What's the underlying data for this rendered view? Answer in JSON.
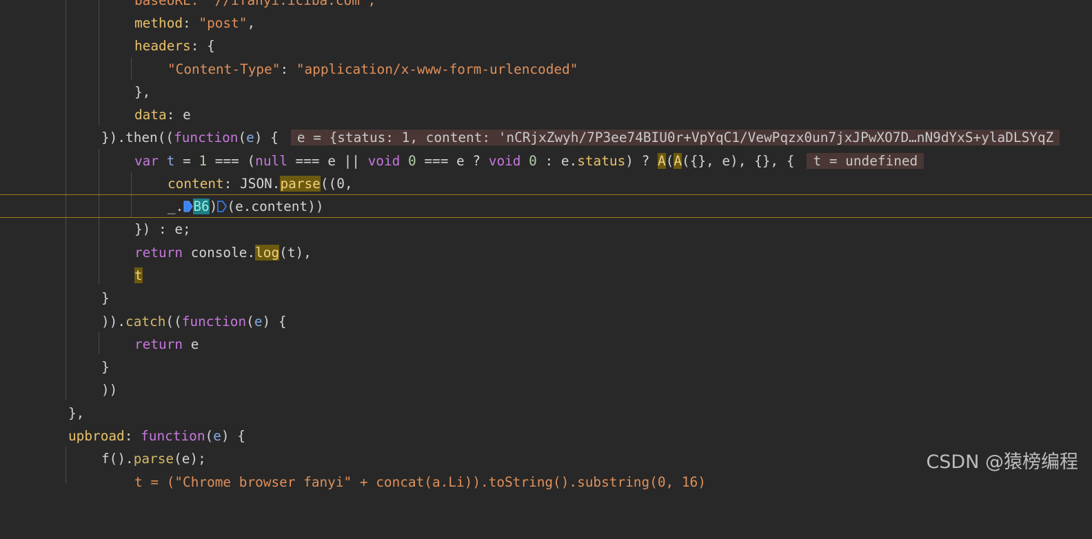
{
  "code_lines": {
    "l0": "baseURL: \"//ifanyi.iciba.com\",",
    "l1_key": "method",
    "l1_val": "\"post\"",
    "l2_key": "headers",
    "l3_key": "\"Content-Type\"",
    "l3_val": "\"application/x-www-form-urlencoded\"",
    "l4": "},",
    "l5_key": "data",
    "l5_val": "e",
    "l6_pre": "}).then((",
    "l6_fn": "function",
    "l6_param": "e",
    "l6_post": ") {",
    "l6_inline": "e = {status: 1, content: 'nCRjxZwyh/7P3ee74BIU0r+VpYqC1/VewPqzx0un7jxJPwXO7D…nN9dYxS+ylaDLSYqZ",
    "l7_var": "var",
    "l7_t": "t",
    "l7_eq": " = ",
    "l7_1": "1",
    "l7_mid1": " === (",
    "l7_null": "null",
    "l7_mid2": " === e || ",
    "l7_void1": "void",
    "l7_0a": " 0",
    "l7_mid3": " === e ? ",
    "l7_void2": "void",
    "l7_0b": " 0",
    "l7_mid4": " : e.",
    "l7_status": "status",
    "l7_mid5": ") ? ",
    "l7_A1": "A",
    "l7_A2": "A",
    "l7_tail": "({}, e), {}, {",
    "l7_inline": "t = undefined",
    "l8_key": "content",
    "l8_json": "JSON.",
    "l8_parse": "parse",
    "l8_tail": "((0,",
    "l9_pre": "_.",
    "l9_b6": "B6",
    "l9_mid": ")",
    "l9_tail": "(e.content))",
    "l10": "}) : e;",
    "l11_ret": "return",
    "l11_mid": " console.",
    "l11_log": "log",
    "l11_tail": "(t),",
    "l12_t": "t",
    "l13": "}",
    "l14_pre": ")).",
    "l14_catch": "catch",
    "l14_open": "((",
    "l14_fn": "function",
    "l14_param": "e",
    "l14_post": ") {",
    "l15_ret": "return",
    "l15_e": " e",
    "l16": "}",
    "l17": "))",
    "l18": "},",
    "l19_key": "upbroad",
    "l19_fn": "function",
    "l19_param": "e",
    "l19_post": ") {",
    "l20_pre": "f().",
    "l20_parse": "parse",
    "l20_tail": "(e);",
    "l21": "t = (\"Chrome browser fanyi\" + concat(a.Li)).toString().substring(0, 16)"
  },
  "watermark": "CSDN @猿榜编程",
  "colors": {
    "background": "#282828",
    "keyword": "#c678dd",
    "string": "#e0905a",
    "property": "#e8c16a",
    "highlight": "#6b5a10",
    "current_expression": "#1f7d86",
    "paused_line_border": "#a07d1c",
    "inline_value_bg": "#4a3735"
  },
  "icons": [
    "breakpoint-marker-icon",
    "breakpoint-marker-icon"
  ]
}
